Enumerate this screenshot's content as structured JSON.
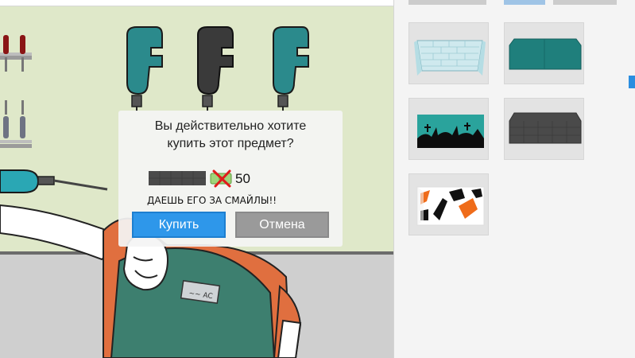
{
  "dialog": {
    "question_line1": "Вы действительно хотите",
    "question_line2": "купить этот предмет?",
    "price": "50",
    "offer_text": "ДАЕШЬ ЕГО ЗА СМАЙЛЫ!!",
    "buy_label": "Купить",
    "cancel_label": "Отмена",
    "icons": [
      "item-preview-icon",
      "cash-crossed-icon"
    ]
  },
  "name_tag_text": "~~ AC",
  "shop_items": [
    {
      "name": "brick-wall-item",
      "colors": [
        "#cfe9ee",
        "#a9d6de"
      ]
    },
    {
      "name": "teal-panel-item",
      "colors": [
        "#1f7f7c"
      ]
    },
    {
      "name": "graveyard-item",
      "colors": [
        "#2aa39c",
        "#0d0d0d"
      ]
    },
    {
      "name": "dark-tile-item",
      "colors": [
        "#4a4a4a"
      ]
    },
    {
      "name": "orange-camo-item",
      "colors": [
        "#ef6c1a",
        "#111111"
      ]
    }
  ],
  "colors": {
    "wall": "#dfe8c9",
    "floor": "#cfcfcf",
    "uniform": "#3d7f6f",
    "sleeve": "#e06f3f",
    "buy_button": "#2e97ea",
    "cancel_button": "#9a9a9a"
  }
}
